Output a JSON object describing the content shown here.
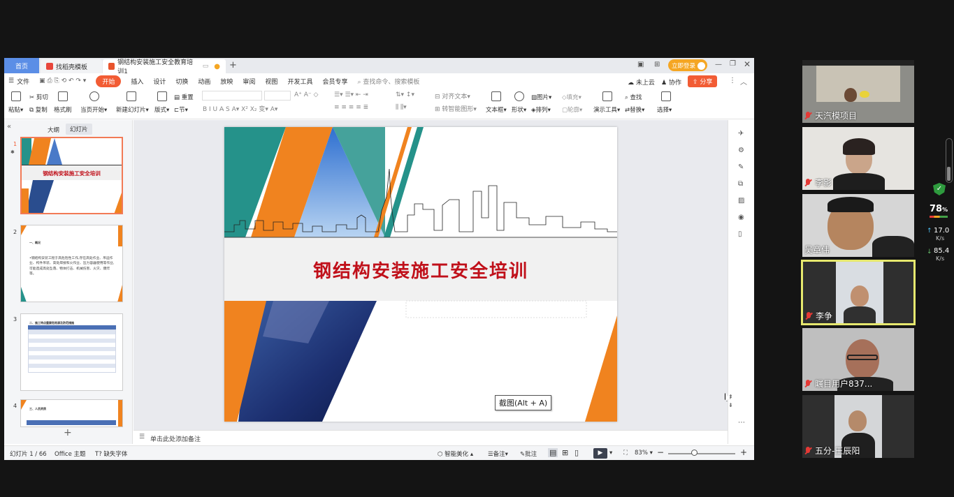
{
  "tabs": {
    "home": "首页",
    "template": "找稻壳模板",
    "doc": "钢结构安装施工安全教育培训1"
  },
  "titlebar": {
    "cloud": "未上云",
    "collab": "协作",
    "share": "分享",
    "login": "立即登录"
  },
  "menubar": {
    "file": "文件",
    "items": [
      "开始",
      "插入",
      "设计",
      "切换",
      "动画",
      "放映",
      "审阅",
      "视图",
      "开发工具",
      "会员专享"
    ],
    "search_placeholder": "查找命令、搜索模板"
  },
  "ribbon": {
    "paste": "粘贴",
    "cut": "剪切",
    "copy": "复制",
    "format_painter": "格式刷",
    "from_current": "当页开始",
    "new_slide": "新建幻灯片",
    "layout": "版式",
    "section": "节",
    "reset": "重置",
    "align_text": "对齐文本",
    "smart_art": "转智能图形",
    "textbox": "文本框",
    "shape": "形状",
    "arrange": "排列",
    "picture": "图片",
    "fill": "填充",
    "outline": "轮廓",
    "present_tools": "演示工具",
    "find": "查找",
    "replace": "替换",
    "select": "选择"
  },
  "left_pane": {
    "outline_tab": "大纲",
    "slides_tab": "幻灯片",
    "slides": [
      {
        "num": "1",
        "title": "钢结构安装施工安全培训"
      },
      {
        "num": "2",
        "title": "一、概况",
        "body": "•钢结构安装工程于高危险性工作,存在高处作业、吊运作业、构件吊装、高处焊接和火作业、压力容器使用等作业,可能造成高处坠落、物体打击、机械伤害、火灾、爆炸等。"
      },
      {
        "num": "3",
        "title": "二、施工特点重要危险源及防范措施"
      },
      {
        "num": "4",
        "title": "三、人员资质"
      }
    ]
  },
  "slide": {
    "title": "钢结构安装施工安全培训",
    "tooltip": "截图(Alt + A)"
  },
  "notes_placeholder": "单击此处添加备注",
  "status": {
    "slide_count": "幻灯片 1 / 66",
    "theme": "Office 主题",
    "missing_font": "缺失字体",
    "beautify": "智能美化",
    "notes": "备注",
    "comments": "批注",
    "zoom": "83%"
  },
  "participants": [
    {
      "name": "天汽模项目"
    },
    {
      "name": "李影"
    },
    {
      "name": "吴章伟"
    },
    {
      "name": "李争"
    },
    {
      "name": "瞩目用户837..."
    },
    {
      "name": "五分-王辰阳"
    }
  ],
  "widget": {
    "battery": "78",
    "battery_unit": "%",
    "up_speed": "17.0",
    "up_unit": "K/s",
    "down_speed": "85.4",
    "down_unit": "K/s"
  },
  "colors": {
    "orange": "#f0831f",
    "teal": "#25928a",
    "title_red": "#c0101a",
    "active_menu": "#f25c34",
    "tab_blue": "#5b8ee6",
    "speaker_highlight": "#e6e86e"
  }
}
